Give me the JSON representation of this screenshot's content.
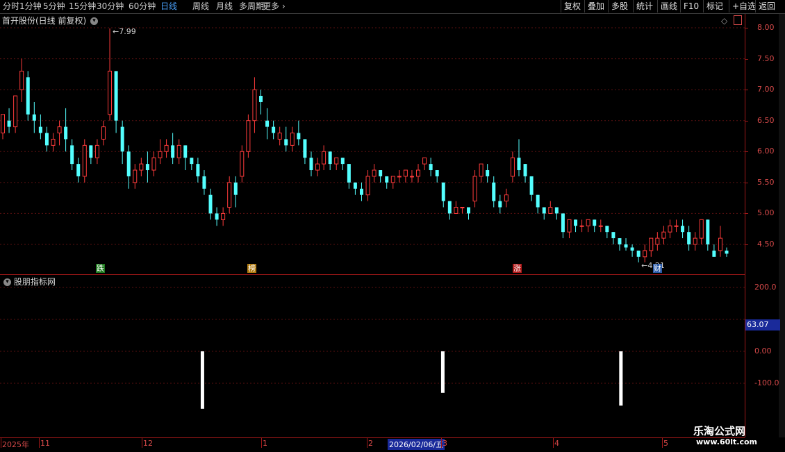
{
  "toolbar": {
    "tabs": [
      "分时",
      "1分钟",
      "5分钟",
      "15分钟",
      "30分钟",
      "60分钟",
      "日线",
      "周线",
      "月线",
      "多周期",
      "更多"
    ],
    "active_tab": "日线",
    "more_label": "更多",
    "right_buttons": [
      "复权",
      "叠加",
      "多股",
      "统计",
      "画线",
      "F10",
      "标记",
      "+自选",
      "返回"
    ]
  },
  "chart_header": {
    "title": "首开股份(日线 前复权)",
    "high_label": "7.99",
    "low_label": "4.21"
  },
  "price_axis": [
    "8.00",
    "7.50",
    "7.00",
    "6.50",
    "6.00",
    "5.50",
    "5.00",
    "4.50"
  ],
  "markers": [
    {
      "text": "跌",
      "color": "#1f7a1f"
    },
    {
      "text": "榜",
      "color": "#b07a10"
    },
    {
      "text": "涨",
      "color": "#b01818"
    },
    {
      "text": "财",
      "color": "#2a5aa8"
    }
  ],
  "indicator": {
    "title": "股朋指标网",
    "axis": [
      "200.0",
      "0.00",
      "-100.0"
    ],
    "current_value": "63.07",
    "bars": [
      {
        "date_index": 70,
        "top": 0,
        "bottom": -180
      },
      {
        "date_index": 155,
        "top": 0,
        "bottom": -130
      },
      {
        "date_index": 218,
        "top": 0,
        "bottom": -170
      }
    ]
  },
  "date_axis": [
    "2025年",
    "11",
    "12",
    "1",
    "2",
    "2026/02/06/五",
    "3",
    "4",
    "5"
  ],
  "watermark": {
    "line1": "乐淘公式网",
    "line2": "www.60lt.com"
  },
  "chart_data": {
    "type": "candlestick",
    "title": "首开股份(日线 前复权)",
    "ylim": [
      4.1,
      8.1
    ],
    "max_price": 7.99,
    "min_price": 4.21,
    "up_color": "#ff3b3b",
    "down_color": "#54ffff",
    "candles": [
      [
        6.3,
        6.6,
        6.2,
        6.5
      ],
      [
        6.5,
        6.4,
        6.3,
        6.7
      ],
      [
        6.4,
        6.9,
        6.3,
        6.9
      ],
      [
        7.0,
        7.3,
        6.8,
        7.5
      ],
      [
        7.2,
        6.6,
        6.5,
        7.3
      ],
      [
        6.6,
        6.5,
        6.3,
        6.8
      ],
      [
        6.4,
        6.3,
        6.2,
        6.6
      ],
      [
        6.3,
        6.1,
        6.0,
        6.4
      ],
      [
        6.1,
        6.2,
        6.0,
        6.3
      ],
      [
        6.3,
        6.4,
        6.1,
        6.5
      ],
      [
        6.4,
        6.2,
        6.0,
        6.7
      ],
      [
        6.1,
        5.8,
        5.7,
        6.2
      ],
      [
        5.8,
        5.6,
        5.5,
        5.9
      ],
      [
        5.6,
        6.1,
        5.5,
        6.2
      ],
      [
        6.1,
        5.9,
        5.8,
        6.1
      ],
      [
        5.9,
        6.1,
        5.8,
        6.2
      ],
      [
        6.2,
        6.4,
        6.1,
        6.5
      ],
      [
        6.6,
        7.3,
        6.5,
        7.99
      ],
      [
        7.3,
        6.5,
        6.3,
        7.3
      ],
      [
        6.4,
        6.0,
        5.8,
        6.5
      ],
      [
        6.0,
        5.6,
        5.4,
        6.1
      ],
      [
        5.5,
        5.7,
        5.4,
        5.8
      ],
      [
        5.7,
        5.8,
        5.6,
        5.9
      ],
      [
        5.8,
        5.7,
        5.5,
        6.0
      ],
      [
        5.7,
        5.9,
        5.6,
        6.0
      ],
      [
        5.9,
        6.0,
        5.8,
        6.2
      ],
      [
        6.0,
        6.1,
        5.9,
        6.2
      ],
      [
        6.1,
        5.9,
        5.8,
        6.3
      ],
      [
        5.9,
        6.1,
        5.8,
        6.2
      ],
      [
        6.1,
        5.9,
        5.7,
        6.1
      ],
      [
        5.9,
        5.8,
        5.7,
        5.9
      ],
      [
        5.8,
        5.6,
        5.5,
        5.9
      ],
      [
        5.6,
        5.4,
        5.3,
        5.7
      ],
      [
        5.3,
        5.0,
        4.9,
        5.4
      ],
      [
        5.0,
        4.9,
        4.8,
        5.1
      ],
      [
        4.9,
        5.0,
        4.8,
        5.1
      ],
      [
        5.1,
        5.5,
        5.0,
        5.6
      ],
      [
        5.5,
        5.3,
        5.1,
        5.6
      ],
      [
        5.6,
        6.0,
        5.5,
        6.1
      ],
      [
        6.0,
        6.5,
        5.9,
        6.6
      ],
      [
        6.5,
        7.0,
        6.3,
        7.2
      ],
      [
        6.9,
        6.8,
        6.6,
        7.0
      ],
      [
        6.5,
        6.4,
        6.2,
        6.7
      ],
      [
        6.4,
        6.3,
        6.2,
        6.5
      ],
      [
        6.2,
        6.3,
        6.1,
        6.4
      ],
      [
        6.2,
        6.1,
        6.0,
        6.4
      ],
      [
        6.1,
        6.3,
        6.0,
        6.4
      ],
      [
        6.3,
        6.2,
        6.1,
        6.5
      ],
      [
        6.2,
        5.9,
        5.8,
        6.2
      ],
      [
        5.9,
        5.7,
        5.6,
        6.0
      ],
      [
        5.7,
        5.8,
        5.6,
        5.9
      ],
      [
        5.8,
        6.0,
        5.7,
        6.1
      ],
      [
        6.0,
        5.8,
        5.7,
        6.0
      ],
      [
        5.8,
        5.9,
        5.7,
        5.9
      ],
      [
        5.9,
        5.8,
        5.7,
        5.9
      ],
      [
        5.8,
        5.5,
        5.4,
        5.8
      ],
      [
        5.5,
        5.4,
        5.3,
        5.5
      ],
      [
        5.4,
        5.3,
        5.2,
        5.5
      ],
      [
        5.3,
        5.6,
        5.2,
        5.7
      ],
      [
        5.6,
        5.7,
        5.5,
        5.8
      ],
      [
        5.7,
        5.6,
        5.5,
        5.7
      ],
      [
        5.6,
        5.5,
        5.4,
        5.6
      ],
      [
        5.5,
        5.6,
        5.4,
        5.6
      ],
      [
        5.6,
        5.6,
        5.5,
        5.7
      ],
      [
        5.6,
        5.7,
        5.5,
        5.7
      ],
      [
        5.6,
        5.6,
        5.5,
        5.7
      ],
      [
        5.6,
        5.7,
        5.5,
        5.8
      ],
      [
        5.8,
        5.9,
        5.7,
        5.9
      ],
      [
        5.8,
        5.7,
        5.6,
        5.9
      ],
      [
        5.7,
        5.6,
        5.5,
        5.7
      ],
      [
        5.5,
        5.2,
        5.1,
        5.5
      ],
      [
        5.2,
        5.0,
        4.9,
        5.2
      ],
      [
        5.0,
        5.1,
        5.0,
        5.2
      ],
      [
        5.1,
        5.1,
        5.0,
        5.1
      ],
      [
        5.1,
        5.0,
        4.9,
        5.1
      ],
      [
        5.2,
        5.6,
        5.1,
        5.7
      ],
      [
        5.6,
        5.8,
        5.5,
        5.8
      ],
      [
        5.7,
        5.6,
        5.5,
        5.8
      ],
      [
        5.5,
        5.2,
        5.1,
        5.6
      ],
      [
        5.2,
        5.1,
        5.0,
        5.3
      ],
      [
        5.2,
        5.3,
        5.1,
        5.4
      ],
      [
        5.6,
        5.9,
        5.5,
        6.0
      ],
      [
        5.9,
        5.7,
        5.6,
        6.2
      ],
      [
        5.8,
        5.6,
        5.5,
        5.8
      ],
      [
        5.6,
        5.3,
        5.2,
        5.6
      ],
      [
        5.3,
        5.1,
        5.0,
        5.3
      ],
      [
        5.1,
        5.0,
        4.9,
        5.1
      ],
      [
        5.0,
        5.1,
        5.0,
        5.2
      ],
      [
        5.1,
        5.0,
        4.9,
        5.1
      ],
      [
        5.0,
        4.7,
        4.6,
        5.0
      ],
      [
        4.7,
        4.9,
        4.6,
        4.9
      ],
      [
        4.9,
        4.8,
        4.7,
        4.9
      ],
      [
        4.8,
        4.8,
        4.7,
        4.9
      ],
      [
        4.8,
        4.9,
        4.7,
        4.9
      ],
      [
        4.9,
        4.8,
        4.7,
        4.9
      ],
      [
        4.8,
        4.8,
        4.7,
        4.9
      ],
      [
        4.8,
        4.7,
        4.6,
        4.8
      ],
      [
        4.7,
        4.6,
        4.5,
        4.7
      ],
      [
        4.6,
        4.5,
        4.4,
        4.6
      ],
      [
        4.5,
        4.45,
        4.4,
        4.6
      ],
      [
        4.45,
        4.4,
        4.3,
        4.5
      ],
      [
        4.4,
        4.3,
        4.21,
        4.4
      ],
      [
        4.3,
        4.4,
        4.21,
        4.5
      ],
      [
        4.4,
        4.6,
        4.3,
        4.6
      ],
      [
        4.5,
        4.6,
        4.4,
        4.7
      ],
      [
        4.6,
        4.7,
        4.5,
        4.8
      ],
      [
        4.7,
        4.8,
        4.6,
        4.9
      ],
      [
        4.8,
        4.8,
        4.7,
        4.9
      ],
      [
        4.8,
        4.7,
        4.6,
        4.9
      ],
      [
        4.7,
        4.5,
        4.4,
        4.8
      ],
      [
        4.5,
        4.6,
        4.4,
        4.7
      ],
      [
        4.6,
        4.9,
        4.5,
        4.9
      ],
      [
        4.9,
        4.5,
        4.4,
        4.9
      ],
      [
        4.4,
        4.3,
        4.3,
        4.5
      ],
      [
        4.4,
        4.6,
        4.3,
        4.8
      ],
      [
        4.4,
        4.35,
        4.3,
        4.45
      ]
    ]
  }
}
